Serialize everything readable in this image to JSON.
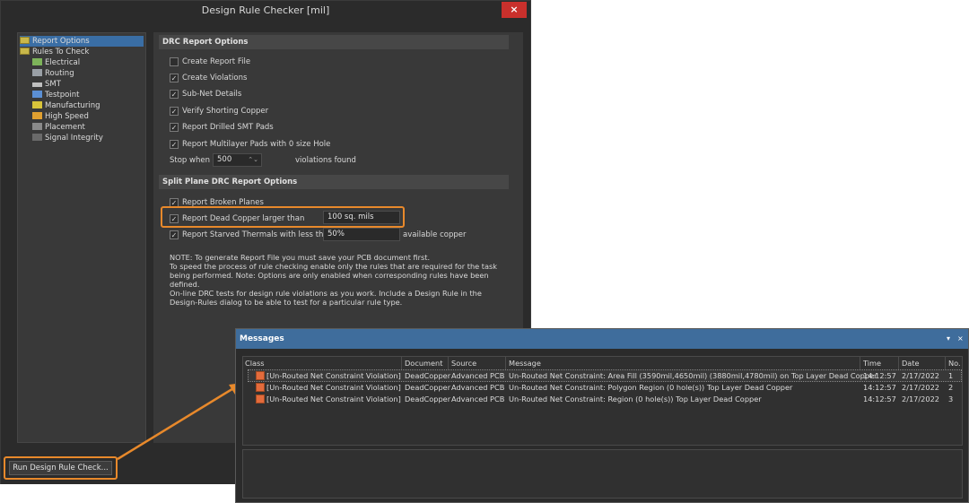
{
  "dialog": {
    "title": "Design Rule Checker [mil]",
    "close_glyph": "×",
    "tree": [
      {
        "label": "Report Options",
        "icon": "folder-icon",
        "selected": true
      },
      {
        "label": "Rules To Check",
        "icon": "folder-icon"
      },
      {
        "label": "Electrical",
        "icon": "electrical-icon"
      },
      {
        "label": "Routing",
        "icon": "routing-icon"
      },
      {
        "label": "SMT",
        "icon": "smt-icon"
      },
      {
        "label": "Testpoint",
        "icon": "testpoint-icon"
      },
      {
        "label": "Manufacturing",
        "icon": "manufacturing-icon"
      },
      {
        "label": "High Speed",
        "icon": "high-speed-icon"
      },
      {
        "label": "Placement",
        "icon": "placement-icon"
      },
      {
        "label": "Signal Integrity",
        "icon": "signal-integrity-icon"
      }
    ],
    "drc_section": "DRC Report Options",
    "drc_options": [
      {
        "label": "Create Report File",
        "checked": false
      },
      {
        "label": "Create Violations",
        "checked": true
      },
      {
        "label": "Sub-Net Details",
        "checked": true
      },
      {
        "label": "Verify Shorting Copper",
        "checked": true
      },
      {
        "label": "Report Drilled SMT Pads",
        "checked": true
      },
      {
        "label": "Report Multilayer Pads with 0 size Hole",
        "checked": true
      }
    ],
    "stop_when": {
      "label": "Stop when",
      "value": "500",
      "suffix": "violations found"
    },
    "split_section": "Split Plane DRC Report Options",
    "split_options": [
      {
        "label": "Report Broken Planes",
        "checked": true
      },
      {
        "label": "Report Dead Copper larger than",
        "checked": true,
        "value": "100 sq. mils"
      },
      {
        "label": "Report Starved Thermals with less than",
        "checked": true,
        "value": "50%",
        "suffix": "available copper"
      }
    ],
    "note_lines": [
      "NOTE: To generate Report File you must save your PCB document first.",
      "To speed the process of rule checking enable only the rules that are required for the task",
      "being performed.  Note: Options are only enabled when corresponding rules have been",
      "defined.",
      "On-line DRC tests for design rule violations as you work. Include a Design Rule in the",
      "Design-Rules dialog to be able to test for a particular rule  type."
    ],
    "run_button": "Run Design Rule Check..."
  },
  "messages": {
    "title": "Messages",
    "controls": [
      "▾",
      "×"
    ],
    "columns": [
      "Class",
      "Document",
      "Source",
      "Message",
      "Time",
      "Date",
      "No."
    ],
    "rows": [
      {
        "class": "[Un-Routed Net Constraint Violation]",
        "document": "DeadCopper",
        "source": "Advanced PCB",
        "message": "Un-Routed Net Constraint: Area Fill (3590mil,4650mil) (3880mil,4780mil) on Top Layer Dead Copper",
        "time": "14:12:57",
        "date": "2/17/2022",
        "no": "1"
      },
      {
        "class": "[Un-Routed Net Constraint Violation]",
        "document": "DeadCopper",
        "source": "Advanced PCB",
        "message": "Un-Routed Net Constraint: Polygon Region (0 hole(s)) Top Layer Dead Copper",
        "time": "14:12:57",
        "date": "2/17/2022",
        "no": "2"
      },
      {
        "class": "[Un-Routed Net Constraint Violation]",
        "document": "DeadCopper",
        "source": "Advanced PCB",
        "message": "Un-Routed Net Constraint: Region (0 hole(s)) Top Layer Dead Copper",
        "time": "14:12:57",
        "date": "2/17/2022",
        "no": "3"
      }
    ]
  },
  "colors": {
    "accent": "#e8892b",
    "selection": "#3a6ea5",
    "messages_title": "#3f6d9c",
    "error_icon": "#e36b3c"
  }
}
